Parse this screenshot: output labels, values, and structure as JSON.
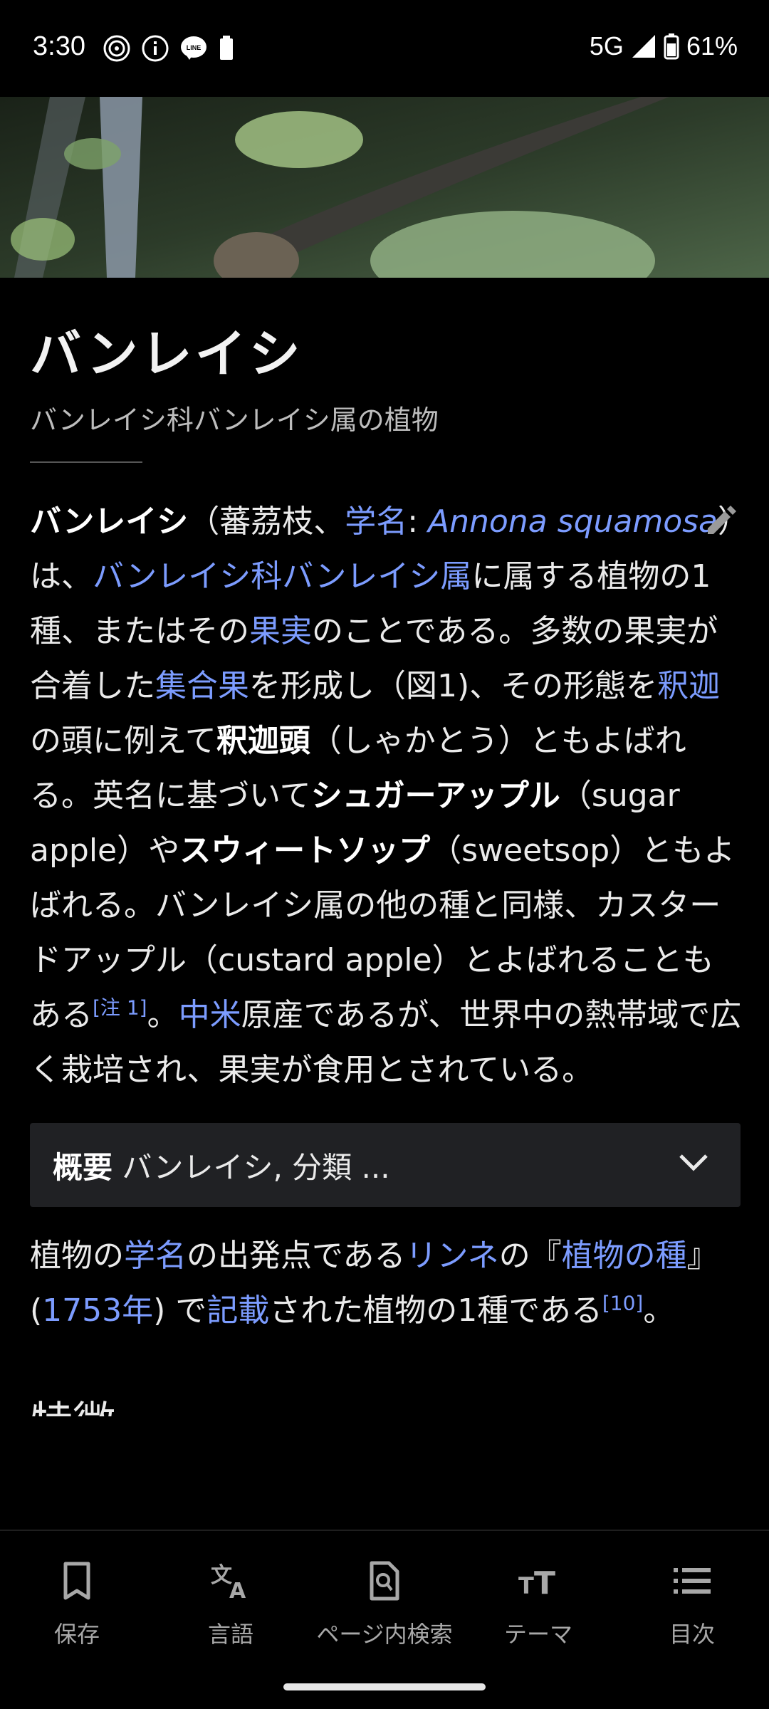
{
  "status_bar": {
    "time": "3:30",
    "network": "5G",
    "battery": "61%",
    "left_icons": [
      "fingerprint-icon",
      "info-icon",
      "line-icon",
      "battery-small-icon"
    ],
    "right_icons": [
      "signal-icon",
      "battery-icon"
    ]
  },
  "article": {
    "title": "バンレイシ",
    "subtitle": "バンレイシ科バンレイシ属の植物",
    "intro": {
      "p1": "バンレイシ",
      "p2": "（蕃茘枝、",
      "p3_link": "学名",
      "p4": ": ",
      "p5_italic_link": "Annona squamosa",
      "p6": "）は、",
      "p7_link": "バンレイシ科バンレイシ属",
      "p8": "に属する植物の1種、またはその",
      "p9_link": "果実",
      "p10": "のことである。多数の果実が合着した",
      "p11_link": "集合果",
      "p12": "を形成し（図1)、その形態を",
      "p13_link": "釈迦",
      "p14": "の頭に例えて",
      "p15_bold": "釈迦頭",
      "p16": "（しゃかとう）ともよばれる。英名に基づいて",
      "p17_bold": "シュガーアップル",
      "p18": "（sugar apple）や",
      "p19_bold": "スウィートソップ",
      "p20": "（sweetsop）ともよばれる。バンレイシ属の他の種と同様、カスタードアップル（custard apple）とよばれることもある",
      "p21_sup": "[注 1]",
      "p22": "。",
      "p23_link": "中米",
      "p24": "原産であるが、世界中の熱帯域で広く栽培され、果実が食用とされている。"
    },
    "infobox": {
      "label": "概要",
      "summary": "バンレイシ, 分類 ..."
    },
    "para2": {
      "a1": "植物の",
      "a2_link": "学名",
      "a3": "の出発点である",
      "a4_link": "リンネ",
      "a5": "の『",
      "a6_link": "植物の種",
      "a7": "』(",
      "a8_link": "1753年",
      "a9": ") で",
      "a10_link": "記載",
      "a11": "された植物の1種である",
      "a12_sup": "[10]",
      "a13": "。"
    },
    "next_section": "特徴"
  },
  "toolbar": {
    "items": [
      {
        "label": "保存",
        "icon": "bookmark-icon"
      },
      {
        "label": "言語",
        "icon": "translate-icon"
      },
      {
        "label": "ページ内検索",
        "icon": "find-in-page-icon"
      },
      {
        "label": "テーマ",
        "icon": "text-size-icon"
      },
      {
        "label": "目次",
        "icon": "list-icon"
      }
    ]
  },
  "colors": {
    "background": "#000000",
    "link": "#7c9cff",
    "infobox_bg": "#202124"
  }
}
